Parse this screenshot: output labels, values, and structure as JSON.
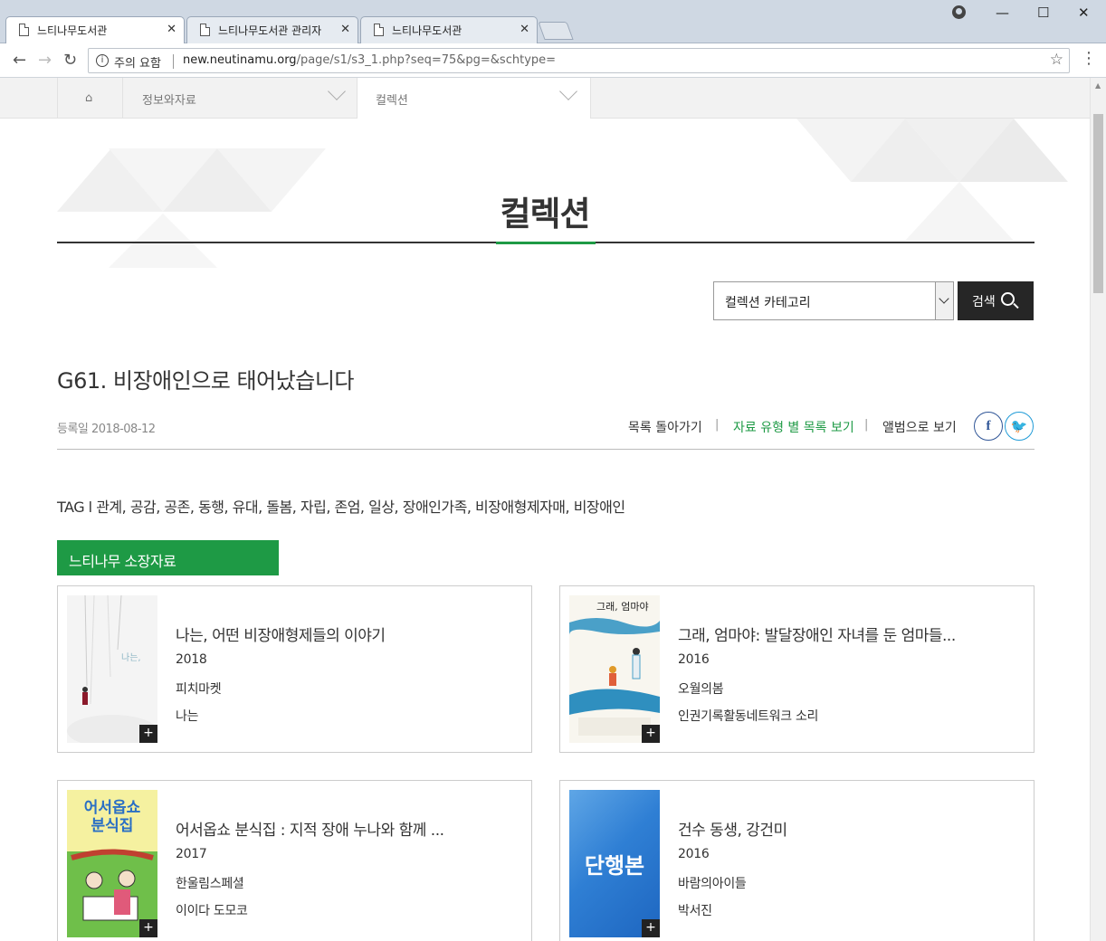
{
  "browser": {
    "tabs": [
      {
        "label": "느티나무도서관",
        "active": true
      },
      {
        "label": "느티나무도서관 관리자",
        "active": false
      },
      {
        "label": "느티나무도서관",
        "active": false
      }
    ],
    "security_label": "주의 요함",
    "url_domain": "new.neutinamu.org",
    "url_path": "/page/s1/s3_1.php?seq=75&pg=&schtype="
  },
  "breadcrumb": {
    "section": "정보와자료",
    "current": "컬렉션"
  },
  "page_title": "컬렉션",
  "search": {
    "category_value": "컬렉션 카테고리",
    "button_label": "검색"
  },
  "item": {
    "title": "G61. 비장애인으로 태어났습니다",
    "reg_date": "등록일 2018-08-12",
    "links": {
      "back": "목록 돌아가기",
      "by_type": "자료 유형 별 목록 보기",
      "album": "앨범으로 보기"
    },
    "tags": "TAG l 관계, 공감, 공존, 동행, 유대, 돌봄, 자립, 존엄, 일상, 장애인가족, 비장애형제자매, 비장애인"
  },
  "holdings": {
    "badge": "느티나무 소장자료",
    "books": [
      {
        "title": "나는, 어떤 비장애형제들의 이야기",
        "year": "2018",
        "publisher": "피치마켓",
        "author": "나는",
        "cover_text": "나는,"
      },
      {
        "title": "그래, 엄마야: 발달장애인 자녀를 둔 엄마들...",
        "year": "2016",
        "publisher": "오월의봄",
        "author": "인권기록활동네트워크 소리",
        "cover_text": "그래, 엄마야"
      },
      {
        "title": "어서옵쇼 분식집 : 지적 장애 누나와 함께 ...",
        "year": "2017",
        "publisher": "한울림스페셜",
        "author": "이이다 도모코",
        "cover_text": "어서옵쇼 분식집"
      },
      {
        "title": "건수 동생, 강건미",
        "year": "2016",
        "publisher": "바람의아이들",
        "author": "박서진",
        "cover_text": "단행본"
      }
    ]
  },
  "colors": {
    "accent_green": "#1e9a45",
    "dark_button": "#262626",
    "facebook": "#2f5597",
    "twitter": "#1f9bd7"
  }
}
